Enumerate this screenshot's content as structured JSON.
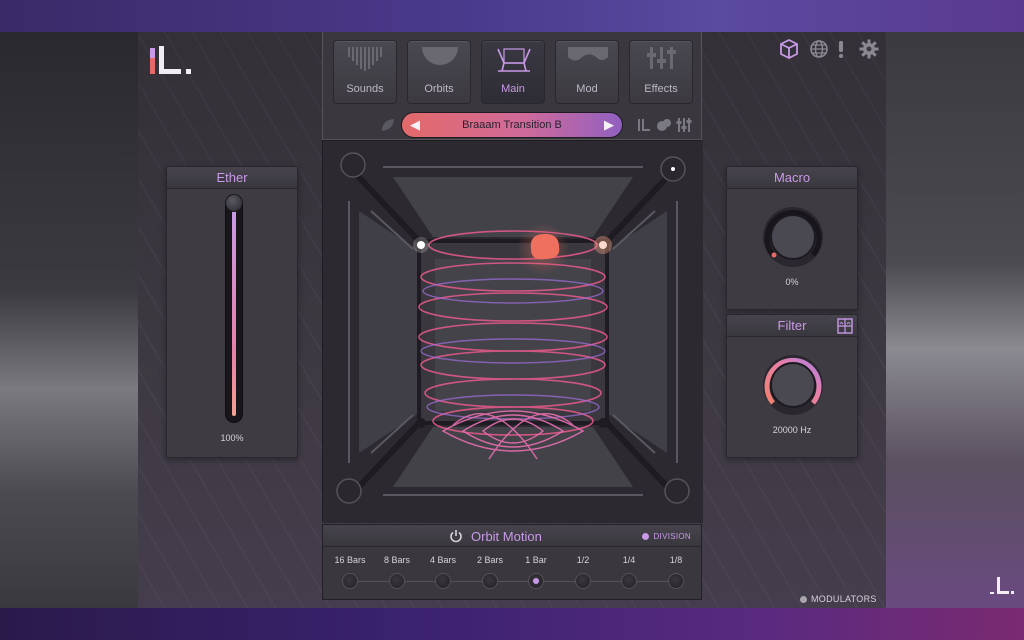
{
  "nav": {
    "tabs": [
      {
        "label": "Sounds",
        "icon": "sounds-icon"
      },
      {
        "label": "Orbits",
        "icon": "orbits-icon"
      },
      {
        "label": "Main",
        "icon": "main-icon"
      },
      {
        "label": "Mod",
        "icon": "mod-icon"
      },
      {
        "label": "Effects",
        "icon": "effects-icon"
      }
    ],
    "active_tab": "Main"
  },
  "preset": {
    "name": "Braaam Transition B",
    "prev_glyph": "◀",
    "next_glyph": "▶"
  },
  "ether": {
    "title": "Ether",
    "value_text": "100%",
    "level": 1.0
  },
  "macro": {
    "title": "Macro",
    "value_text": "0%",
    "level": 0.0
  },
  "filter": {
    "title": "Filter",
    "value_text": "20000 Hz",
    "level": 1.0
  },
  "orbit_motion": {
    "title": "Orbit Motion",
    "division_label": "DIVISION",
    "steps": [
      "16 Bars",
      "8 Bars",
      "4 Bars",
      "2 Bars",
      "1 Bar",
      "1/2",
      "1/4",
      "1/8"
    ],
    "selected": "1 Bar"
  },
  "footer": {
    "modulators_label": "MODULATORS"
  },
  "colors": {
    "accent": "#c89ae8",
    "preset_start": "#e46a6a",
    "preset_end": "#9060c0",
    "orbit_pink": "#e85a8a",
    "orbit_orange": "#f07060"
  }
}
